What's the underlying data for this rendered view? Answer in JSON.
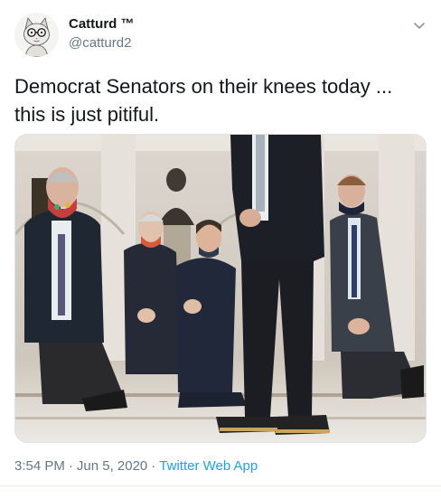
{
  "author": {
    "display_name": "Catturd ™",
    "handle": "@catturd2",
    "avatar_icon": "cat-with-glasses-avatar"
  },
  "tweet": {
    "text": "Democrat Senators on their knees today ... this is just pitiful."
  },
  "media": {
    "alt": "Photo of several senators kneeling in a marble hall wearing face masks"
  },
  "meta": {
    "time": "3:54 PM",
    "separator": "·",
    "date": "Jun 5, 2020",
    "source": "Twitter Web App"
  },
  "icons": {
    "caret": "chevron-down-icon"
  },
  "colors": {
    "name": "#14171a",
    "secondary_text": "#657786",
    "link": "#1da1f2",
    "divider": "#e6ecf0"
  }
}
